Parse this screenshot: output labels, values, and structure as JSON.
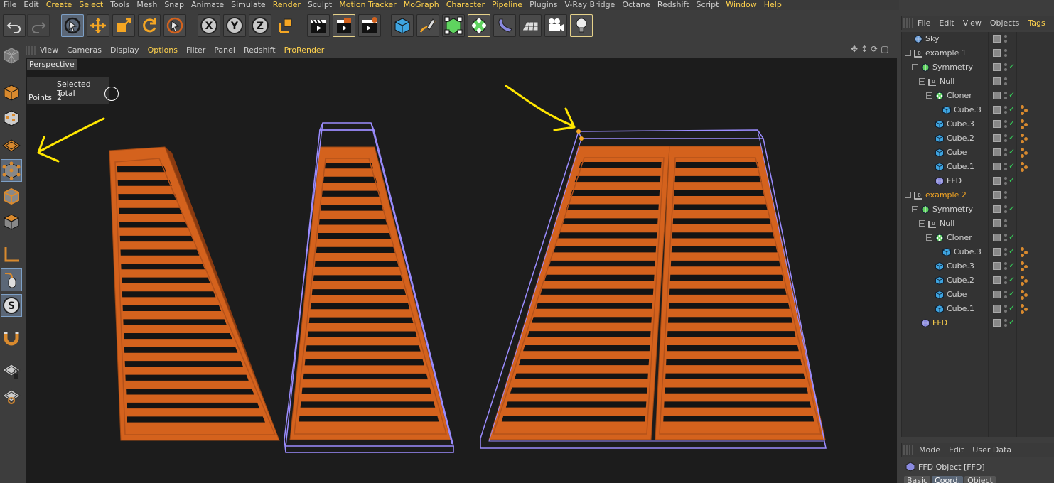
{
  "menubar": [
    {
      "label": "File",
      "hl": false
    },
    {
      "label": "Edit",
      "hl": false
    },
    {
      "label": "Create",
      "hl": true
    },
    {
      "label": "Select",
      "hl": true
    },
    {
      "label": "Tools",
      "hl": false
    },
    {
      "label": "Mesh",
      "hl": false
    },
    {
      "label": "Snap",
      "hl": false
    },
    {
      "label": "Animate",
      "hl": false
    },
    {
      "label": "Simulate",
      "hl": false
    },
    {
      "label": "Render",
      "hl": true
    },
    {
      "label": "Sculpt",
      "hl": false
    },
    {
      "label": "Motion Tracker",
      "hl": true
    },
    {
      "label": "MoGraph",
      "hl": true
    },
    {
      "label": "Character",
      "hl": true
    },
    {
      "label": "Pipeline",
      "hl": true
    },
    {
      "label": "Plugins",
      "hl": false
    },
    {
      "label": "V-Ray Bridge",
      "hl": false
    },
    {
      "label": "Octane",
      "hl": false
    },
    {
      "label": "Redshift",
      "hl": false
    },
    {
      "label": "Script",
      "hl": false
    },
    {
      "label": "Window",
      "hl": true
    },
    {
      "label": "Help",
      "hl": true
    }
  ],
  "toolbar": {
    "axis_x": "X",
    "axis_y": "Y",
    "axis_z": "Z"
  },
  "viewport": {
    "menu": [
      {
        "label": "View",
        "hl": false
      },
      {
        "label": "Cameras",
        "hl": false
      },
      {
        "label": "Display",
        "hl": false
      },
      {
        "label": "Options",
        "hl": true
      },
      {
        "label": "Filter",
        "hl": false
      },
      {
        "label": "Panel",
        "hl": false
      },
      {
        "label": "Redshift",
        "hl": false
      },
      {
        "label": "ProRender",
        "hl": true
      }
    ],
    "title": "Perspective",
    "hud": {
      "header": "Selected Total",
      "row_label": "Points",
      "row_value": "2"
    },
    "colors": {
      "bg": "#1c1c1c",
      "shutter": "#d4621d",
      "shutter_dark": "#8a3a10",
      "cage": "#9b8cff",
      "annotation": "#ffe600"
    }
  },
  "object_manager": {
    "menu": [
      {
        "label": "File",
        "hl": false
      },
      {
        "label": "Edit",
        "hl": false
      },
      {
        "label": "View",
        "hl": false
      },
      {
        "label": "Objects",
        "hl": false
      },
      {
        "label": "Tags",
        "hl": true
      }
    ],
    "rows": [
      {
        "name": "Sky",
        "icon": "sky",
        "style": "",
        "check": false,
        "tags": false
      },
      {
        "name": "example 1",
        "icon": "null",
        "style": "",
        "check": false,
        "tags": false
      },
      {
        "name": "Symmetry",
        "icon": "symmetry",
        "style": "",
        "check": true,
        "tags": false
      },
      {
        "name": "Null",
        "icon": "null",
        "style": "",
        "check": false,
        "tags": false
      },
      {
        "name": "Cloner",
        "icon": "cloner",
        "style": "",
        "check": true,
        "tags": false
      },
      {
        "name": "Cube.3",
        "icon": "cube",
        "style": "",
        "check": true,
        "tags": true
      },
      {
        "name": "Cube.3",
        "icon": "cube",
        "style": "",
        "check": true,
        "tags": true
      },
      {
        "name": "Cube.2",
        "icon": "cube",
        "style": "",
        "check": true,
        "tags": true
      },
      {
        "name": "Cube",
        "icon": "cube",
        "style": "",
        "check": true,
        "tags": true
      },
      {
        "name": "Cube.1",
        "icon": "cube",
        "style": "",
        "check": true,
        "tags": true
      },
      {
        "name": "FFD",
        "icon": "ffd",
        "style": "",
        "check": true,
        "tags": false
      },
      {
        "name": "example 2",
        "icon": "null",
        "style": "hl",
        "check": false,
        "tags": false
      },
      {
        "name": "Symmetry",
        "icon": "symmetry",
        "style": "",
        "check": true,
        "tags": false
      },
      {
        "name": "Null",
        "icon": "null",
        "style": "",
        "check": false,
        "tags": false
      },
      {
        "name": "Cloner",
        "icon": "cloner",
        "style": "",
        "check": true,
        "tags": false
      },
      {
        "name": "Cube.3",
        "icon": "cube",
        "style": "",
        "check": true,
        "tags": true
      },
      {
        "name": "Cube.3",
        "icon": "cube",
        "style": "",
        "check": true,
        "tags": true
      },
      {
        "name": "Cube.2",
        "icon": "cube",
        "style": "",
        "check": true,
        "tags": true
      },
      {
        "name": "Cube",
        "icon": "cube",
        "style": "",
        "check": true,
        "tags": true
      },
      {
        "name": "Cube.1",
        "icon": "cube",
        "style": "",
        "check": true,
        "tags": true
      },
      {
        "name": "FFD",
        "icon": "ffd",
        "style": "fy",
        "check": true,
        "tags": false
      }
    ]
  },
  "attribute_manager": {
    "menu": [
      {
        "label": "Mode"
      },
      {
        "label": "Edit"
      },
      {
        "label": "User Data"
      }
    ],
    "title": "FFD Object [FFD]",
    "tabs": [
      {
        "label": "Basic",
        "sel": false
      },
      {
        "label": "Coord.",
        "sel": true
      },
      {
        "label": "Object",
        "sel": false
      }
    ]
  }
}
